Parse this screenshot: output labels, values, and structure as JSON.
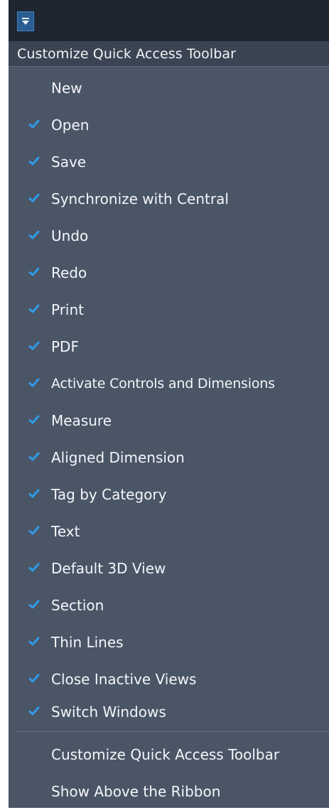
{
  "menu": {
    "title": "Customize Quick Access Toolbar",
    "check_color": "#2f9bea",
    "items": [
      {
        "label": "New",
        "checked": false
      },
      {
        "label": "Open",
        "checked": true
      },
      {
        "label": "Save",
        "checked": true
      },
      {
        "label": "Synchronize with Central",
        "checked": true
      },
      {
        "label": "Undo",
        "checked": true
      },
      {
        "label": "Redo",
        "checked": true
      },
      {
        "label": "Print",
        "checked": true
      },
      {
        "label": "PDF",
        "checked": true
      },
      {
        "label": "Activate Controls and Dimensions",
        "checked": true
      },
      {
        "label": "Measure",
        "checked": true
      },
      {
        "label": "Aligned Dimension",
        "checked": true
      },
      {
        "label": "Tag by Category",
        "checked": true
      },
      {
        "label": "Text",
        "checked": true
      },
      {
        "label": "Default 3D View",
        "checked": true
      },
      {
        "label": "Section",
        "checked": true
      },
      {
        "label": "Thin Lines",
        "checked": true
      },
      {
        "label": "Close Inactive Views",
        "checked": true
      },
      {
        "label": "Switch Windows",
        "checked": true
      }
    ],
    "footer_items": [
      {
        "label": "Customize Quick Access Toolbar"
      },
      {
        "label": "Show Above the Ribbon"
      }
    ]
  }
}
